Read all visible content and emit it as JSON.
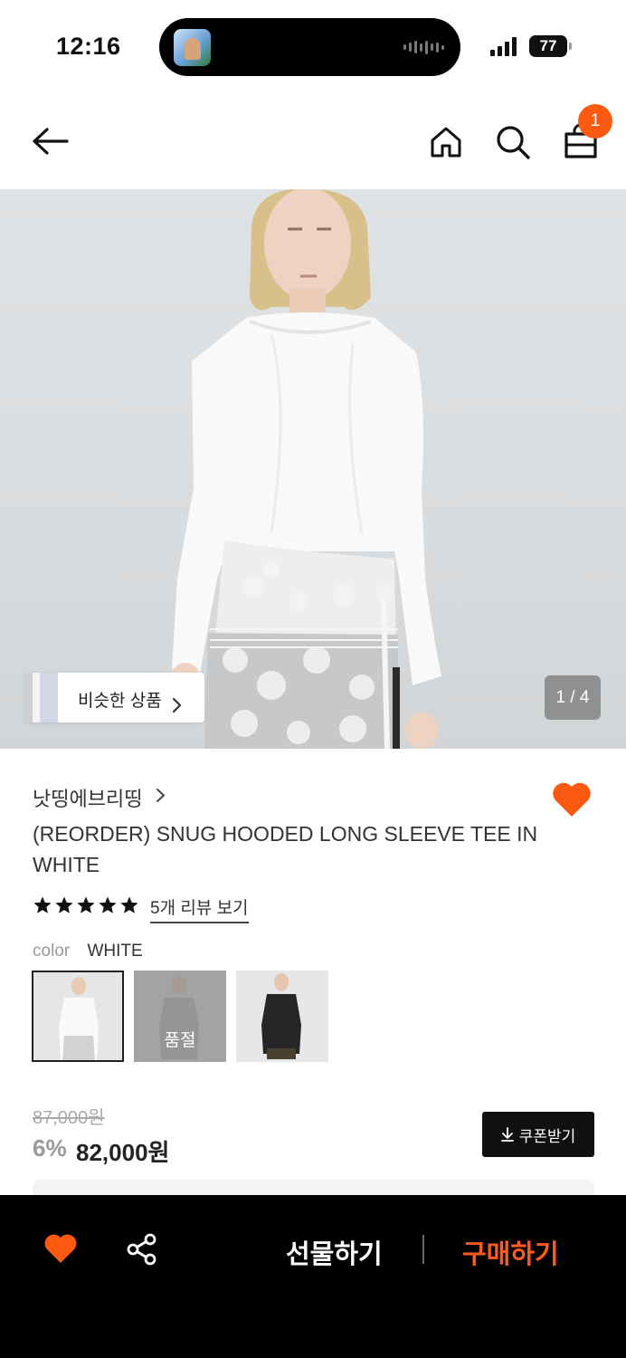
{
  "status_bar": {
    "time": "12:16",
    "battery": "77"
  },
  "nav": {
    "cart_count": "1"
  },
  "hero": {
    "similar_label": "비슷한 상품",
    "counter": "1 / 4"
  },
  "product": {
    "brand": "낫띵에브리띵",
    "title": "(REORDER) SNUG HOODED LONG SLEEVE TEE IN WHITE",
    "rating_stars": 5,
    "review_link": "5개 리뷰 보기",
    "color_label": "color",
    "color_value": "WHITE",
    "swatches": [
      {
        "name": "white",
        "selected": true,
        "sold_out": false
      },
      {
        "name": "grey",
        "selected": false,
        "sold_out": true,
        "sold_out_label": "품절"
      },
      {
        "name": "black",
        "selected": false,
        "sold_out": false
      }
    ],
    "original_price": "87,000원",
    "discount": "6%",
    "price": "82,000원",
    "coupon_label": "쿠폰받기"
  },
  "bottom_bar": {
    "gift_label": "선물하기",
    "buy_label": "구매하기"
  },
  "colors": {
    "accent": "#fb5a10",
    "buy": "#ff5a1f",
    "bar": "#000000"
  },
  "icons": [
    "back-arrow-icon",
    "home-icon",
    "search-icon",
    "shopping-bag-icon",
    "heart-icon",
    "share-icon",
    "download-icon",
    "star-icon",
    "chevron-right-icon"
  ]
}
